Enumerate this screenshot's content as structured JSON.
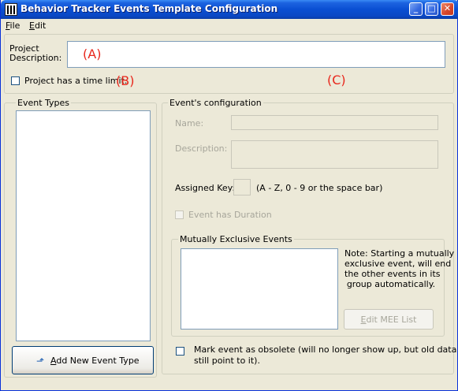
{
  "window": {
    "title": "Behavior Tracker Events Template Configuration",
    "minimize_glyph": "_",
    "maximize_glyph": "□",
    "close_glyph": "✕"
  },
  "menu": {
    "file_prefix": "F",
    "file_rest": "ile",
    "edit_prefix": "E",
    "edit_rest": "dit"
  },
  "project": {
    "description_label_line1": "Project",
    "description_label_line2": "Description:",
    "description_value": "",
    "time_limit_label": "Project has a time limit.",
    "time_limit_checked": false
  },
  "annotations": {
    "a": "(A)",
    "b": "(B)",
    "c": "(C)",
    "color": "#e8271c"
  },
  "event_types": {
    "group_title": "Event Types",
    "items": [],
    "add_button_prefix": "",
    "add_button_mnemonic": "A",
    "add_button_rest": "dd New Event Type"
  },
  "event_config": {
    "group_title": "Event's configuration",
    "name_label": "Name:",
    "name_value": "",
    "description_label": "Description:",
    "description_value": "",
    "assigned_key_label": "Assigned Key:",
    "assigned_key_value": "",
    "assigned_key_hint": "(A - Z, 0 - 9 or the space bar)",
    "has_duration_label": "Event has Duration",
    "has_duration_checked": false
  },
  "mutually_exclusive": {
    "group_title": "Mutually Exclusive Events",
    "items": [],
    "note_line1": "Note: Starting a mutually",
    "note_line2": "exclusive event, will end",
    "note_line3": "the other events in its",
    "note_line4": "group automatically.",
    "edit_button_mnemonic": "E",
    "edit_button_rest": "dit MEE List"
  },
  "obsolete": {
    "label_line1": "Mark event as obsolete (will no longer show up, but old data can",
    "label_line2": "still point to it).",
    "checked": false
  }
}
